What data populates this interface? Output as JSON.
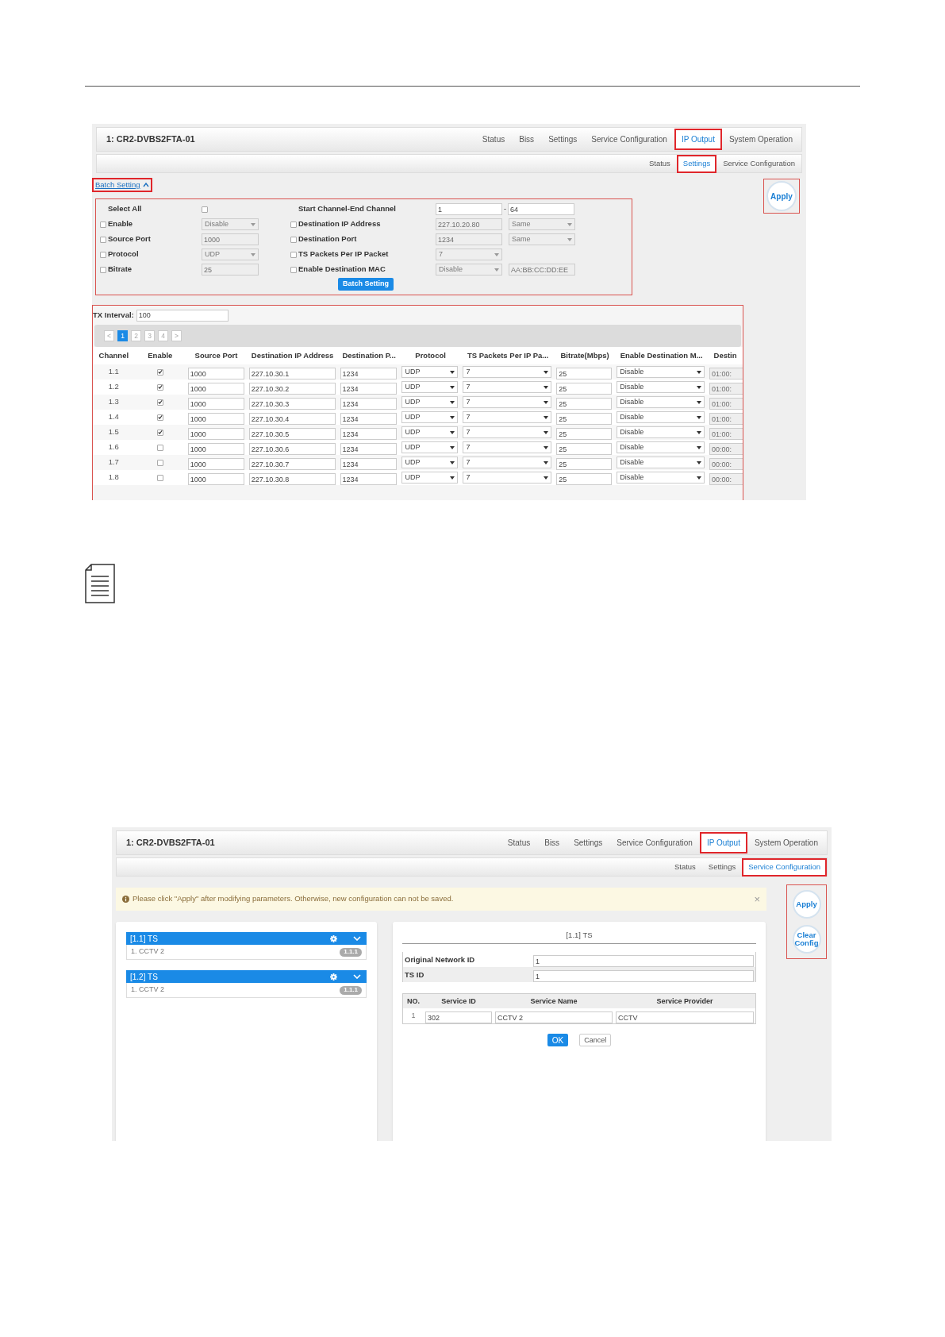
{
  "settings_screen": {
    "title": "1: CR2-DVBS2FTA-01",
    "tabs": [
      {
        "label": "Status",
        "selected": false,
        "highlighted": false
      },
      {
        "label": "Biss",
        "selected": false,
        "highlighted": false
      },
      {
        "label": "Settings",
        "selected": false,
        "highlighted": false
      },
      {
        "label": "Service Configuration",
        "selected": false,
        "highlighted": false
      },
      {
        "label": "IP Output",
        "selected": true,
        "highlighted": true
      },
      {
        "label": "System Operation",
        "selected": false,
        "highlighted": false
      }
    ],
    "subtabs": [
      {
        "label": "Status",
        "selected": false,
        "highlighted": false
      },
      {
        "label": "Settings",
        "selected": true,
        "highlighted": true
      },
      {
        "label": "Service Configuration",
        "selected": false,
        "highlighted": false
      }
    ],
    "batch_link": {
      "label": "Batch Setting",
      "expanded": true,
      "highlighted": true
    },
    "batch": {
      "highlighted": true,
      "left": [
        {
          "label": "Select All",
          "controls": [
            {
              "kind": "checkbox",
              "checked": false
            }
          ]
        },
        {
          "label": "Enable",
          "checked": false,
          "controls": [
            {
              "kind": "select",
              "value": "Disable",
              "disabled": true
            }
          ]
        },
        {
          "label": "Source Port",
          "checked": false,
          "controls": [
            {
              "kind": "input",
              "value": "1000",
              "disabled": true
            }
          ]
        },
        {
          "label": "Protocol",
          "checked": false,
          "controls": [
            {
              "kind": "select",
              "value": "UDP",
              "disabled": true
            }
          ]
        },
        {
          "label": "Bitrate",
          "checked": false,
          "controls": [
            {
              "kind": "input",
              "value": "25",
              "disabled": true
            }
          ]
        }
      ],
      "right": [
        {
          "label": "Start Channel-End Channel",
          "controls": [
            {
              "kind": "input",
              "value": "1",
              "disabled": false
            },
            {
              "kind": "separator",
              "text": "-"
            },
            {
              "kind": "input",
              "value": "64",
              "disabled": false
            }
          ]
        },
        {
          "label": "Destination IP Address",
          "checked": false,
          "controls": [
            {
              "kind": "input",
              "value": "227.10.20.80",
              "disabled": true
            },
            {
              "kind": "select",
              "value": "Same",
              "disabled": true
            }
          ]
        },
        {
          "label": "Destination Port",
          "checked": false,
          "controls": [
            {
              "kind": "input",
              "value": "1234",
              "disabled": true
            },
            {
              "kind": "select",
              "value": "Same",
              "disabled": true
            }
          ]
        },
        {
          "label": "TS Packets Per IP Packet",
          "checked": false,
          "controls": [
            {
              "kind": "select",
              "value": "7",
              "disabled": true
            }
          ]
        },
        {
          "label": "Enable Destination MAC",
          "checked": false,
          "controls": [
            {
              "kind": "select",
              "value": "Disable",
              "disabled": true
            },
            {
              "kind": "input",
              "value": "AA:BB:CC:DD:EE",
              "disabled": true
            }
          ]
        }
      ],
      "button": "Batch Setting"
    },
    "apply": {
      "label": "Apply",
      "highlighted": true
    },
    "table": {
      "highlighted": true,
      "tx_label": "TX Interval:",
      "tx_value": "100",
      "pager": [
        {
          "label": "<",
          "selected": false
        },
        {
          "label": "1",
          "selected": true
        },
        {
          "label": "2",
          "selected": false
        },
        {
          "label": "3",
          "selected": false
        },
        {
          "label": "4",
          "selected": false
        },
        {
          "label": ">",
          "selected": false
        }
      ],
      "columns": [
        "Channel",
        "Enable",
        "Source Port",
        "Destination IP Address",
        "Destination P...",
        "Protocol",
        "TS Packets Per IP Pa...",
        "Bitrate(Mbps)",
        "Enable Destination M...",
        "Destin"
      ],
      "rows": [
        {
          "channel": "1.1",
          "enabled": true,
          "source_port": "1000",
          "destination_ip": "227.10.30.1",
          "destination_port": "1234",
          "protocol": "UDP",
          "ts_packets": "7",
          "bitrate": "25",
          "mac_mode": "Disable",
          "column_10": "01:00:"
        },
        {
          "channel": "1.2",
          "enabled": true,
          "source_port": "1000",
          "destination_ip": "227.10.30.2",
          "destination_port": "1234",
          "protocol": "UDP",
          "ts_packets": "7",
          "bitrate": "25",
          "mac_mode": "Disable",
          "column_10": "01:00:"
        },
        {
          "channel": "1.3",
          "enabled": true,
          "source_port": "1000",
          "destination_ip": "227.10.30.3",
          "destination_port": "1234",
          "protocol": "UDP",
          "ts_packets": "7",
          "bitrate": "25",
          "mac_mode": "Disable",
          "column_10": "01:00:"
        },
        {
          "channel": "1.4",
          "enabled": true,
          "source_port": "1000",
          "destination_ip": "227.10.30.4",
          "destination_port": "1234",
          "protocol": "UDP",
          "ts_packets": "7",
          "bitrate": "25",
          "mac_mode": "Disable",
          "column_10": "01:00:"
        },
        {
          "channel": "1.5",
          "enabled": true,
          "source_port": "1000",
          "destination_ip": "227.10.30.5",
          "destination_port": "1234",
          "protocol": "UDP",
          "ts_packets": "7",
          "bitrate": "25",
          "mac_mode": "Disable",
          "column_10": "01:00:"
        },
        {
          "channel": "1.6",
          "enabled": false,
          "source_port": "1000",
          "destination_ip": "227.10.30.6",
          "destination_port": "1234",
          "protocol": "UDP",
          "ts_packets": "7",
          "bitrate": "25",
          "mac_mode": "Disable",
          "column_10": "00:00:"
        },
        {
          "channel": "1.7",
          "enabled": false,
          "source_port": "1000",
          "destination_ip": "227.10.30.7",
          "destination_port": "1234",
          "protocol": "UDP",
          "ts_packets": "7",
          "bitrate": "25",
          "mac_mode": "Disable",
          "column_10": "00:00:"
        },
        {
          "channel": "1.8",
          "enabled": false,
          "source_port": "1000",
          "destination_ip": "227.10.30.8",
          "destination_port": "1234",
          "protocol": "UDP",
          "ts_packets": "7",
          "bitrate": "25",
          "mac_mode": "Disable",
          "column_10": "00:00:"
        }
      ]
    }
  },
  "service_screen": {
    "title": "1: CR2-DVBS2FTA-01",
    "tabs": [
      {
        "label": "Status",
        "selected": false,
        "highlighted": false
      },
      {
        "label": "Biss",
        "selected": false,
        "highlighted": false
      },
      {
        "label": "Settings",
        "selected": false,
        "highlighted": false
      },
      {
        "label": "Service Configuration",
        "selected": false,
        "highlighted": false
      },
      {
        "label": "IP Output",
        "selected": true,
        "highlighted": true
      },
      {
        "label": "System Operation",
        "selected": false,
        "highlighted": false
      }
    ],
    "subtabs": [
      {
        "label": "Status",
        "selected": false,
        "highlighted": false
      },
      {
        "label": "Settings",
        "selected": false,
        "highlighted": false
      },
      {
        "label": "Service Configuration",
        "selected": true,
        "highlighted": true
      }
    ],
    "alert": {
      "text": "Please click \"Apply\" after modifying parameters. Otherwise, new configuration can not be saved.",
      "close": "×"
    },
    "actions": {
      "highlighted": true,
      "buttons": [
        "Apply",
        "Clear Config"
      ]
    },
    "ts_groups": [
      {
        "title": "[1.1] TS",
        "items": [
          {
            "label": "1. CCTV 2",
            "badge": "1.1.1"
          }
        ]
      },
      {
        "title": "[1.2] TS",
        "items": [
          {
            "label": "1. CCTV 2",
            "badge": "1.1.1"
          }
        ]
      }
    ],
    "detail": {
      "title": "[1.1] TS",
      "fields": [
        {
          "label": "Original Network ID",
          "value": "1"
        },
        {
          "label": "TS ID",
          "value": "1"
        }
      ],
      "service_columns": [
        "NO.",
        "Service ID",
        "Service Name",
        "Service Provider"
      ],
      "services": [
        {
          "no": "1",
          "service_id": "302",
          "service_name": "CCTV 2",
          "service_provider": "CCTV"
        }
      ],
      "ok": "OK",
      "cancel": "Cancel"
    }
  }
}
